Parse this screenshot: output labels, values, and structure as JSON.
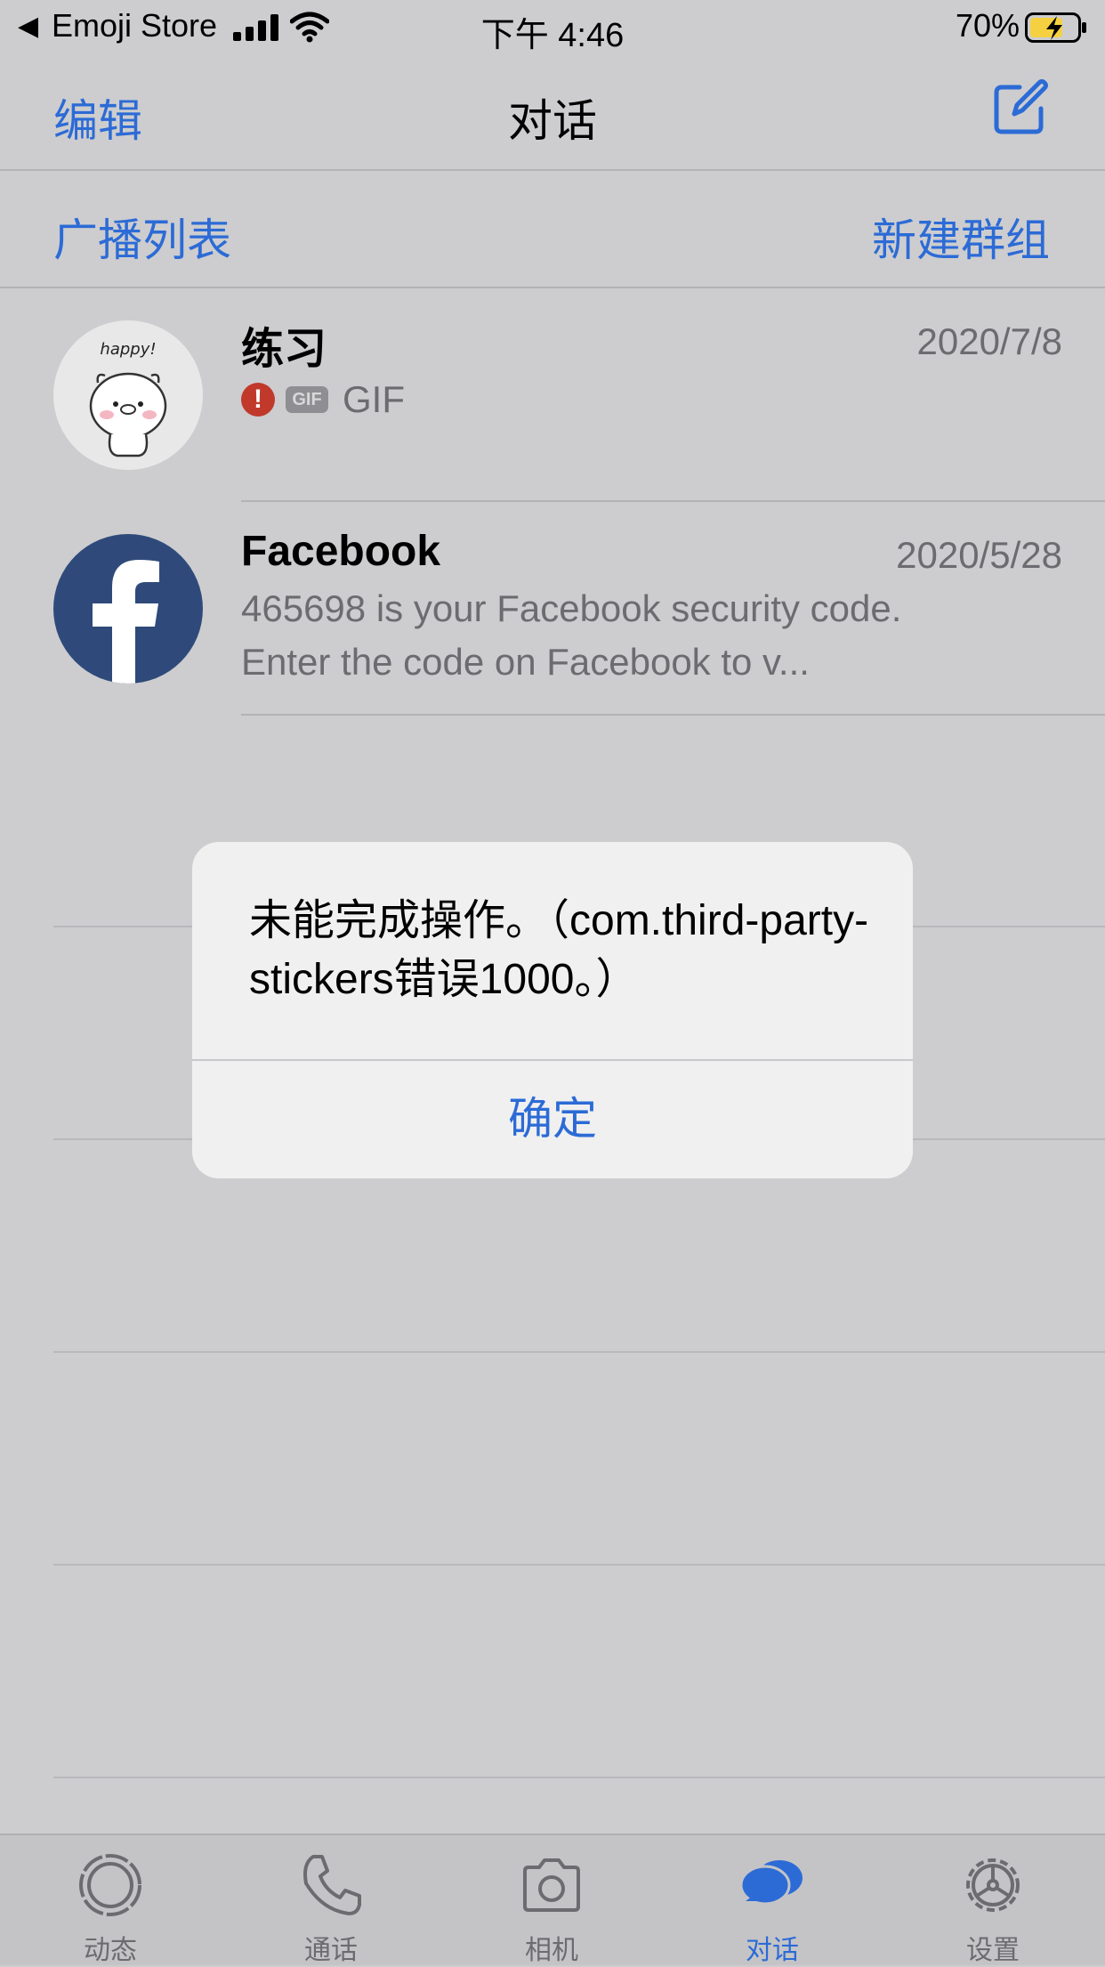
{
  "status_bar": {
    "back_app": "Emoji Store",
    "time": "下午 4:46",
    "battery": "70%"
  },
  "navbar": {
    "edit": "编辑",
    "title": "对话",
    "compose_icon": "compose-icon"
  },
  "subheader": {
    "broadcast": "广播列表",
    "new_group": "新建群组"
  },
  "chats": [
    {
      "name": "练习",
      "date": "2020/7/8",
      "avatar_text": "happy!",
      "gif_badge": "GIF",
      "preview": "GIF"
    },
    {
      "name": "Facebook",
      "date": "2020/5/28",
      "preview": "465698 is your Facebook security code. Enter the code on Facebook to v..."
    }
  ],
  "alert": {
    "message": "未能完成操作。（com.third-party-stickers错误1000。）",
    "ok": "确定"
  },
  "tabs": [
    {
      "label": "动态",
      "icon": "status-icon",
      "active": false
    },
    {
      "label": "通话",
      "icon": "phone-icon",
      "active": false
    },
    {
      "label": "相机",
      "icon": "camera-icon",
      "active": false
    },
    {
      "label": "对话",
      "icon": "chats-icon",
      "active": true
    },
    {
      "label": "设置",
      "icon": "settings-icon",
      "active": false
    }
  ],
  "colors": {
    "accent": "#2c6bd6",
    "background": "#cdcdcf",
    "secondary_text": "#6c6c70",
    "facebook_blue": "#2f4a7a",
    "error_red": "#c0392b"
  }
}
